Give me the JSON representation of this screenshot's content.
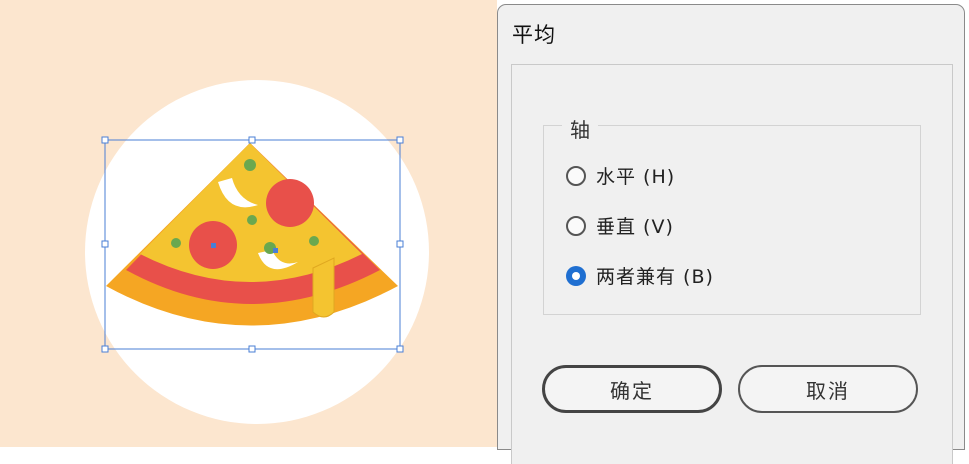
{
  "dialog": {
    "title": "平均",
    "axis_group_label": "轴",
    "options": [
      {
        "label": "水平 (H)",
        "checked": false
      },
      {
        "label": "垂直 (V)",
        "checked": false
      },
      {
        "label": "两者兼有 (B)",
        "checked": true
      }
    ],
    "ok_label": "确定",
    "cancel_label": "取消"
  },
  "colors": {
    "canvas_bg": "#fce6cf",
    "pizza_cheese": "#f4c430",
    "pizza_crust": "#f5a623",
    "sauce_red": "#e8504a",
    "olive_green": "#6aa84f",
    "selection_blue": "#4a7fd6",
    "radio_checked": "#1f6fd1"
  }
}
